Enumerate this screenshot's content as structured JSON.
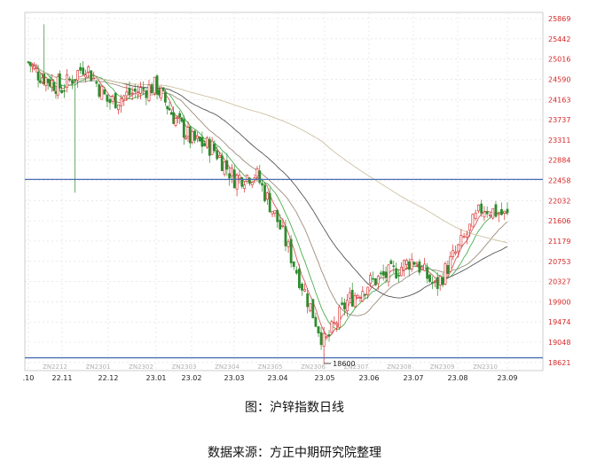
{
  "chart_data": {
    "type": "candlestick",
    "title": "",
    "ylabel": "",
    "xlabel": "",
    "ylim": [
      18450,
      26000
    ],
    "y_ticks": [
      25869,
      25442,
      25016,
      24590,
      24163,
      23737,
      23311,
      22884,
      22458,
      22032,
      21606,
      21179,
      20753,
      20327,
      19900,
      19474,
      19048,
      18621
    ],
    "x_ticks": [
      ".10",
      "22.11",
      "22.12",
      "23.01",
      "23.02",
      "23.03",
      "23.04",
      "23.05",
      "23.06",
      "23.07",
      "23.08",
      "23.09"
    ],
    "contract_labels": [
      "ZN2212",
      "ZN2301",
      "ZN2302",
      "ZN2303",
      "ZN2304",
      "ZN2305",
      "ZN2306",
      "ZN2307",
      "ZN2308",
      "ZN2309",
      "ZN2310"
    ],
    "horizontal_lines": [
      22480,
      18720
    ],
    "low_annotation": {
      "label": "18600",
      "value": 18600
    },
    "month_closes": [
      24950,
      24500,
      24900,
      24000,
      24350,
      23350,
      23000,
      22200,
      21000,
      19050,
      20050,
      20250,
      20450,
      21000,
      20000,
      21950,
      21700
    ],
    "close_anchors_x_months": [
      0,
      0.3,
      1,
      1.5,
      2,
      2.5,
      3,
      3.5,
      4,
      4.5,
      5,
      5.5,
      6,
      6.5,
      7,
      7.5,
      8,
      8.5,
      9,
      9.5,
      10,
      10.5,
      11
    ],
    "moving_averages": [
      {
        "name": "MA5",
        "color": "#d65a5a"
      },
      {
        "name": "MA10",
        "color": "#4caf50"
      },
      {
        "name": "MA20",
        "color": "#9e8e7e"
      },
      {
        "name": "MA40",
        "color": "#555555"
      },
      {
        "name": "MA120",
        "color": "#cdc3a0"
      }
    ],
    "colors": {
      "up": "#d62728",
      "down": "#2e8b2e",
      "axis_text": "#d62728",
      "hline": "#4a6fb3",
      "grid": "#dcdcdc"
    }
  },
  "captions": {
    "figure": "图：沪锌指数日线",
    "source": "数据来源：方正中期研究院整理"
  }
}
